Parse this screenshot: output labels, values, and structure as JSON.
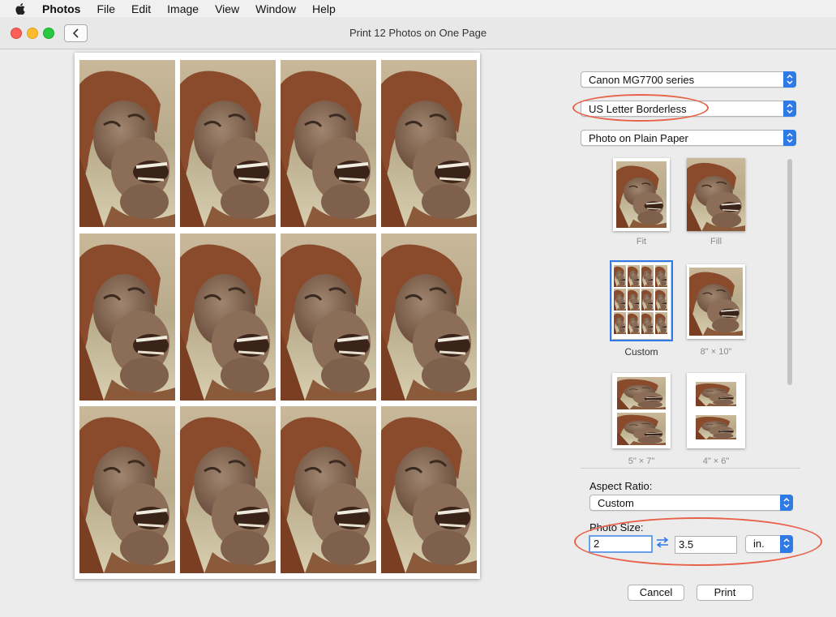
{
  "menubar": {
    "app": "Photos",
    "items": [
      "File",
      "Edit",
      "Image",
      "View",
      "Window",
      "Help"
    ]
  },
  "window": {
    "title": "Print 12 Photos on One Page"
  },
  "settings": {
    "printer": "Canon MG7700 series",
    "paper_size": "US Letter Borderless",
    "paper_type": "Photo on Plain Paper"
  },
  "presets": [
    {
      "label": "Fit"
    },
    {
      "label": "Fill"
    },
    {
      "label": "Custom",
      "selected": true
    },
    {
      "label": "8\" × 10\""
    },
    {
      "label": "5\" × 7\""
    },
    {
      "label": "4\" × 6\""
    }
  ],
  "aspect": {
    "label": "Aspect Ratio:",
    "value": "Custom"
  },
  "photo_size": {
    "label": "Photo Size:",
    "width": "2",
    "height": "3.5",
    "unit": "in."
  },
  "buttons": {
    "cancel": "Cancel",
    "print": "Print"
  },
  "colors": {
    "accent": "#2f7ae5",
    "annotation": "#e8624a"
  }
}
